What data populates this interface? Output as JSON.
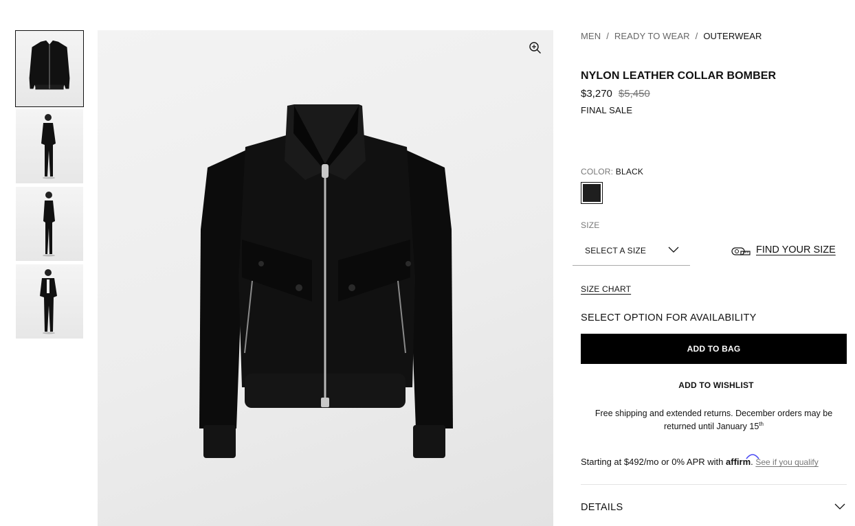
{
  "breadcrumb": [
    "MEN",
    "READY TO WEAR",
    "OUTERWEAR"
  ],
  "breadcrumb_separator": "/",
  "product": {
    "title": "NYLON LEATHER COLLAR BOMBER",
    "price": "$3,270",
    "original_price": "$5,450",
    "sale_note": "FINAL SALE"
  },
  "color": {
    "label": "COLOR:",
    "value": "BLACK",
    "swatch_hex": "#1f1f1f"
  },
  "size": {
    "label": "SIZE",
    "select_placeholder": "SELECT A SIZE",
    "find_your_size": "FIND YOUR SIZE",
    "size_chart": "SIZE CHART"
  },
  "availability": "SELECT OPTION FOR AVAILABILITY",
  "actions": {
    "add_to_bag": "ADD TO BAG",
    "add_to_wishlist": "ADD TO WISHLIST"
  },
  "shipping": {
    "text": "Free shipping and extended returns. December orders may be returned until January 15",
    "suffix": "th"
  },
  "financing": {
    "text": "Starting at $492/mo or 0% APR with",
    "brand": "affirm",
    "link": "See if you qualify"
  },
  "details_label": "DETAILS",
  "icons": {
    "zoom": "zoom-in-icon",
    "measure": "measuring-tape-icon",
    "chevron": "chevron-down-icon"
  },
  "thumbnails": [
    "front-product-shot",
    "model-front",
    "model-side",
    "model-front-open"
  ]
}
